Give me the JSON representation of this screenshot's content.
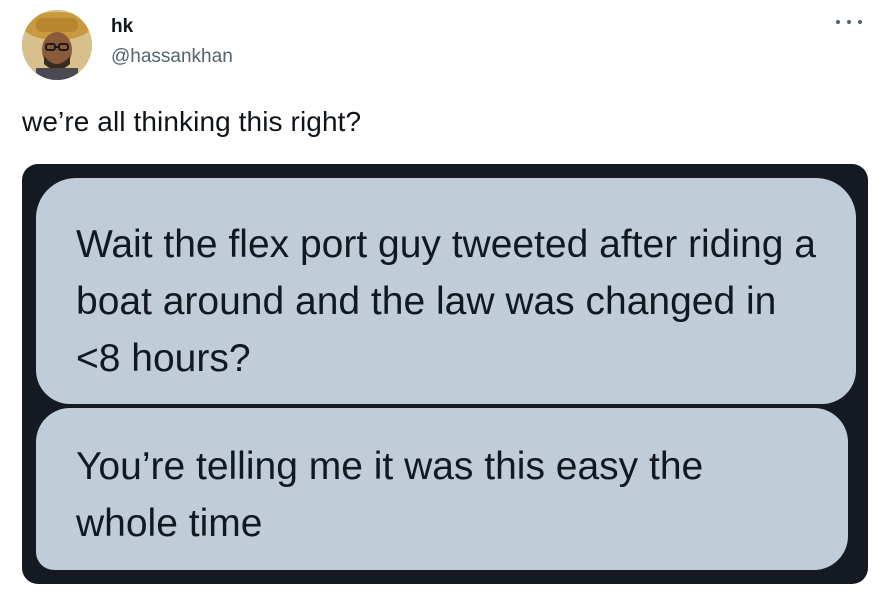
{
  "tweet": {
    "display_name": "hk",
    "handle": "@hassankhan",
    "text": "we’re all thinking this right?",
    "more_icon": "more-horizontal-icon"
  },
  "media": {
    "messages": [
      "Wait the flex port guy tweeted after riding a boat around and the law was changed in <8 hours?",
      "You’re telling me it was this easy the whole time"
    ]
  },
  "colors": {
    "text_primary": "#0f1419",
    "text_secondary": "#536471",
    "media_background": "#141922",
    "bubble_background": "#c1ccd9"
  }
}
